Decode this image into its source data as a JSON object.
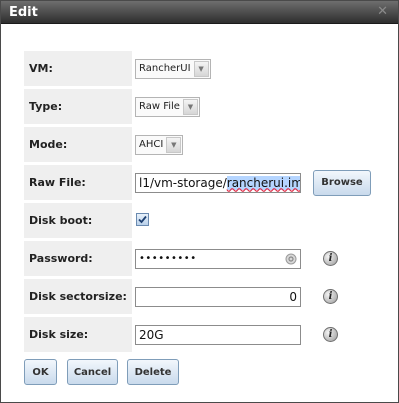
{
  "dialog": {
    "title": "Edit",
    "close_glyph": "✕"
  },
  "form": {
    "vm": {
      "label": "VM:",
      "value": "RancherUI"
    },
    "type": {
      "label": "Type:",
      "value": "Raw File"
    },
    "mode": {
      "label": "Mode:",
      "value": "AHCI"
    },
    "raw_file": {
      "label": "Raw File:",
      "value_prefix": "l1/vm-storage/",
      "value_selected": "rancherui.img",
      "browse_label": "Browse"
    },
    "disk_boot": {
      "label": "Disk boot:",
      "checked": true
    },
    "password": {
      "label": "Password:",
      "masked_value": "•••••••••"
    },
    "disk_sectorsize": {
      "label": "Disk sectorsize:",
      "value": "0"
    },
    "disk_size": {
      "label": "Disk size:",
      "value": "20G"
    }
  },
  "buttons": {
    "ok": "OK",
    "cancel": "Cancel",
    "delete": "Delete"
  },
  "icons": {
    "select_arrow": "chevron-down-icon",
    "info": "info-icon",
    "password_reveal": "key-icon",
    "check": "check-icon"
  },
  "colors": {
    "titlebar": "#3c3c3c",
    "label_bg": "#efefef",
    "button_bg": "#c9daec",
    "selection": "#b5d5ff"
  }
}
